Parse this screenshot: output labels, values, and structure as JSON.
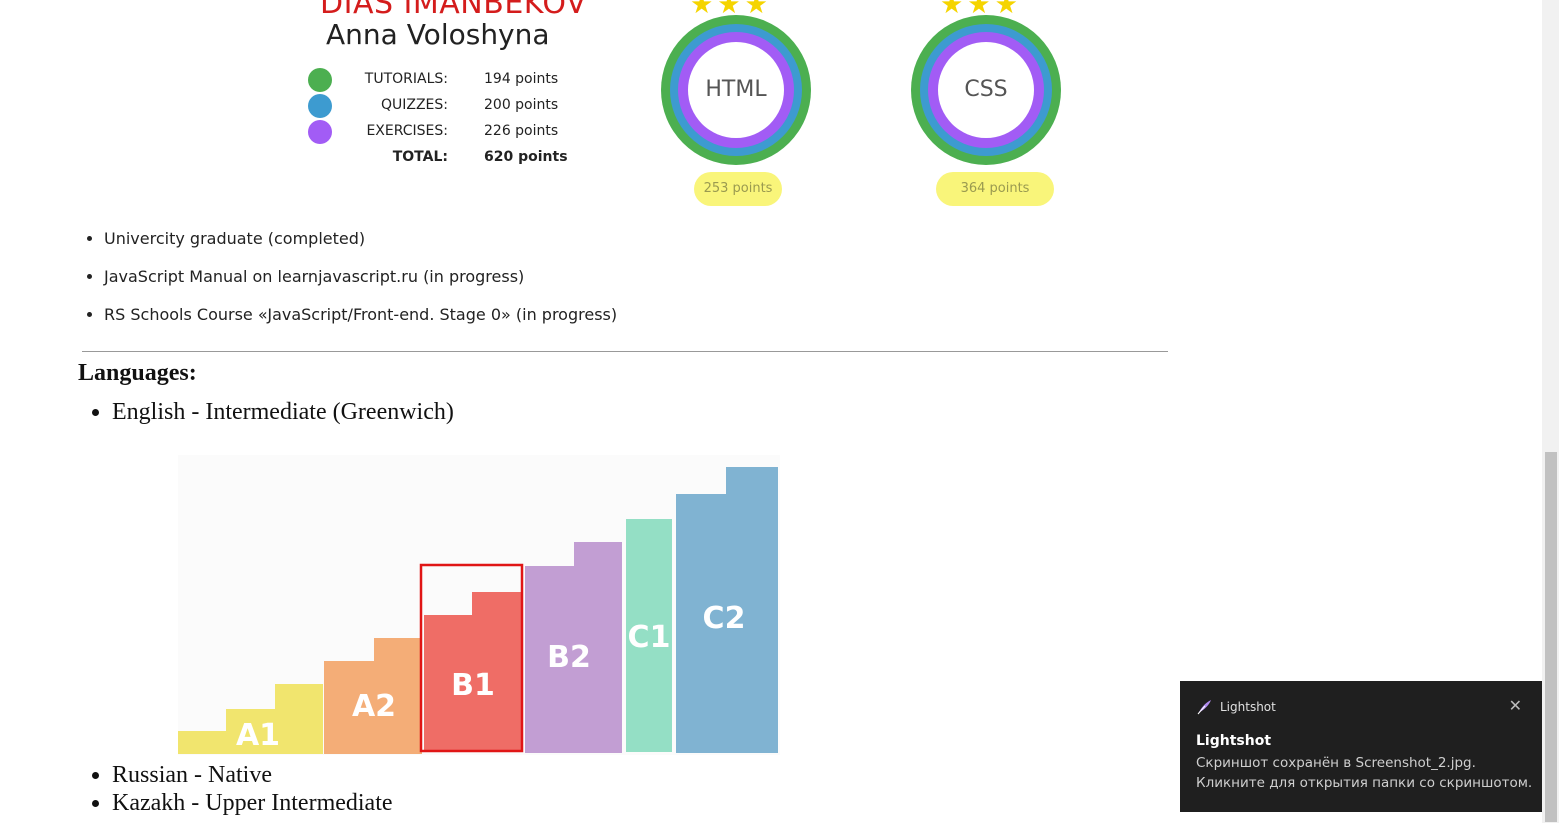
{
  "profile": {
    "name_red": "DIAS IMANBEKOV",
    "name_black": "Anna Voloshyna"
  },
  "stats": [
    {
      "label": "TUTORIALS:",
      "value": "194 points",
      "color": "#4caf50"
    },
    {
      "label": "QUIZZES:",
      "value": "200 points",
      "color": "#3d9bd0"
    },
    {
      "label": "EXERCISES:",
      "value": "226 points",
      "color": "#a25cf5"
    },
    {
      "label": "TOTAL:",
      "value": "620 points"
    }
  ],
  "badges": [
    {
      "label": "HTML",
      "points": "253 points",
      "stars": "★★★"
    },
    {
      "label": "CSS",
      "points": "364 points",
      "stars": "★★★"
    }
  ],
  "education": [
    "Univercity graduate (completed)",
    "JavaScript Manual on learnjavascript.ru (in progress)",
    "RS Schools Course «JavaScript/Front-end. Stage 0» (in progress)"
  ],
  "languages": {
    "heading": "Languages:",
    "english": "English - Intermediate (Greenwich)",
    "russian": "Russian - Native",
    "kazakh": "Kazakh - Upper Intermediate"
  },
  "cefr_levels": {
    "labels": [
      "A1",
      "A2",
      "B1",
      "B2",
      "C1",
      "C2"
    ],
    "colors": [
      "#f1e56e",
      "#f4ad77",
      "#ef6d66",
      "#c29ed3",
      "#94dfc5",
      "#80b3d2"
    ],
    "highlighted": "B1"
  },
  "toast": {
    "app": "Lightshot",
    "title": "Lightshot",
    "message": "Скриншот сохранён в Screenshot_2.jpg. Кликните для открытия папки со скриншотом.",
    "close": "✕"
  }
}
